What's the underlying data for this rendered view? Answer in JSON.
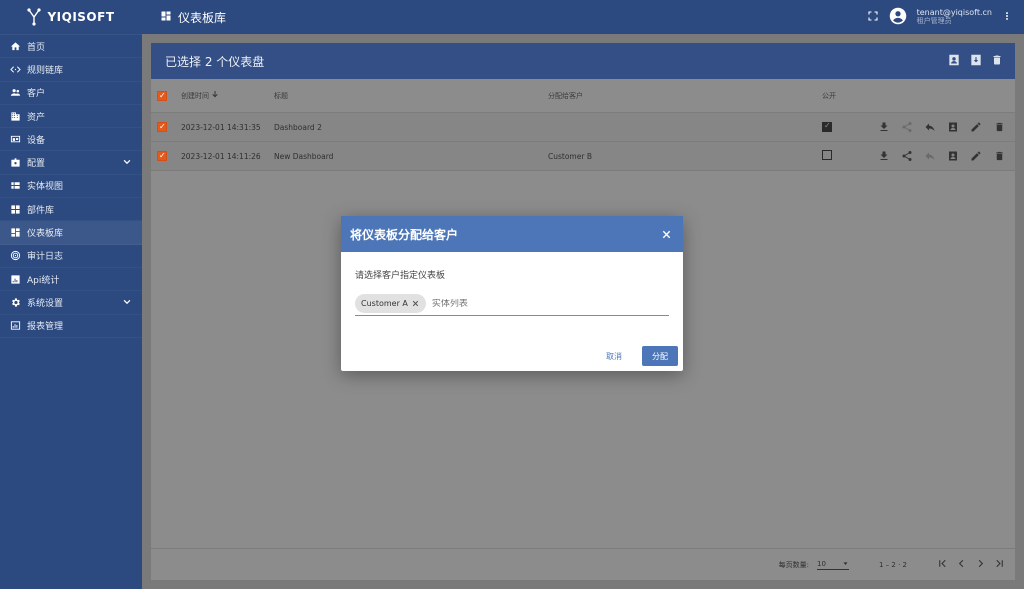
{
  "app": {
    "logo_text": "YIQISOFT"
  },
  "colors": {
    "primary": "#2c4a80",
    "accent": "#e35a1b",
    "dialog_header": "#4c76b8"
  },
  "topbar": {
    "title": "仪表板库",
    "user_email": "tenant@yiqisoft.cn",
    "user_role": "租户管理员"
  },
  "sidebar": {
    "items": [
      {
        "label": "首页",
        "icon": "home-icon"
      },
      {
        "label": "规则链库",
        "icon": "code-icon"
      },
      {
        "label": "客户",
        "icon": "people-icon"
      },
      {
        "label": "资产",
        "icon": "building-icon"
      },
      {
        "label": "设备",
        "icon": "devices-icon"
      },
      {
        "label": "配置",
        "icon": "badge-icon"
      },
      {
        "label": "实体视图",
        "icon": "view-icon"
      },
      {
        "label": "部件库",
        "icon": "widgets-icon"
      },
      {
        "label": "仪表板库",
        "icon": "dashboard-icon"
      },
      {
        "label": "审计日志",
        "icon": "track-icon"
      },
      {
        "label": "Api统计",
        "icon": "chart-icon"
      },
      {
        "label": "系统设置",
        "icon": "settings-icon"
      },
      {
        "label": "报表管理",
        "icon": "report-icon"
      }
    ]
  },
  "card": {
    "header_title": "已选择 2 个仪表盘",
    "columns": {
      "created": "创建时间",
      "title": "标题",
      "assigned": "分配给客户",
      "public": "公开"
    },
    "rows": [
      {
        "created": "2023-12-01 14:31:35",
        "title": "Dashboard 2",
        "assigned": "",
        "public": true
      },
      {
        "created": "2023-12-01 14:11:26",
        "title": "New Dashboard",
        "assigned": "Customer B",
        "public": false
      }
    ],
    "pager": {
      "per_page_label": "每页数量:",
      "per_page_value": "10",
      "range": "1 – 2 · 2"
    }
  },
  "dialog": {
    "title": "将仪表板分配给客户",
    "label": "请选择客户指定仪表板",
    "chip": "Customer A",
    "input_placeholder": "实体列表",
    "cancel": "取消",
    "assign": "分配"
  }
}
